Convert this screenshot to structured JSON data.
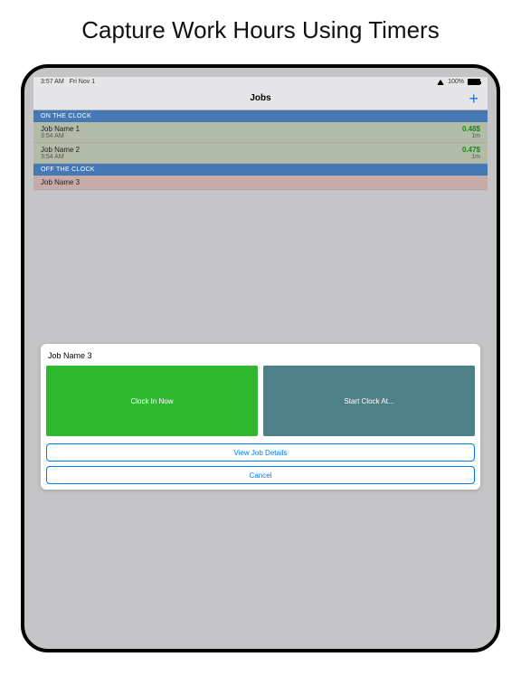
{
  "caption": "Capture Work Hours Using Timers",
  "status": {
    "time": "3:57 AM",
    "date": "Fri Nov 1",
    "battery_pct": "100%"
  },
  "nav": {
    "title": "Jobs",
    "add": "+"
  },
  "sections": {
    "on_clock_header": "ON THE CLOCK",
    "off_clock_header": "OFF THE CLOCK"
  },
  "on_jobs": [
    {
      "name": "Job Name 1",
      "start": "3:54 AM",
      "earn": "0.48$",
      "dur": "1m"
    },
    {
      "name": "Job Name 2",
      "start": "3:54 AM",
      "earn": "0.47$",
      "dur": "1m"
    }
  ],
  "off_jobs": [
    {
      "name": "Job Name 3"
    }
  ],
  "sheet": {
    "title": "Job Name 3",
    "clock_in": "Clock In Now",
    "start_at": "Start Clock At...",
    "view_details": "View Job Details",
    "cancel": "Cancel"
  }
}
